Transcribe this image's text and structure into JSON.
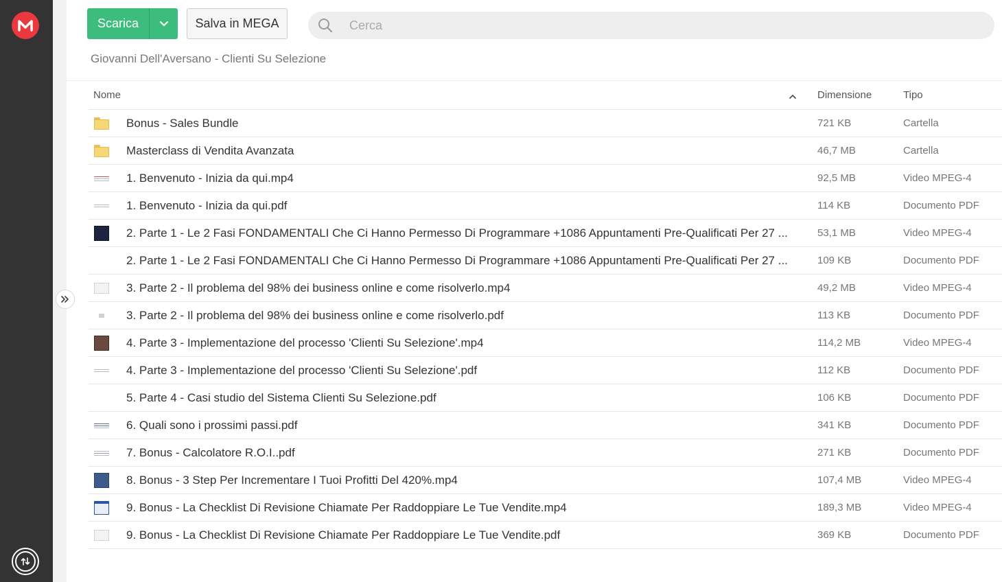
{
  "app": {
    "logo_letter": "M"
  },
  "toolbar": {
    "download_label": "Scarica",
    "save_label": "Salva in MEGA"
  },
  "search": {
    "placeholder": "Cerca"
  },
  "breadcrumb": "Giovanni Dell'Aversano - Clienti Su Selezione",
  "table": {
    "headers": {
      "name": "Nome",
      "size": "Dimensione",
      "type": "Tipo"
    },
    "rows": [
      {
        "thumb": "folder-icon",
        "name": "Bonus - Sales Bundle",
        "size": "721 KB",
        "type": "Cartella"
      },
      {
        "thumb": "folder-icon",
        "name": "Masterclass di Vendita Avanzata",
        "size": "46,7 MB",
        "type": "Cartella"
      },
      {
        "thumb": "video-thumbnail",
        "name": "1. Benvenuto - Inizia da qui.mp4",
        "size": "92,5 MB",
        "type": "Video MPEG-4"
      },
      {
        "thumb": "pdf-thumbnail",
        "name": "1. Benvenuto - Inizia da qui.pdf",
        "size": "114 KB",
        "type": "Documento PDF"
      },
      {
        "thumb": "video-thumbnail",
        "name": "2. Parte 1 - Le 2 Fasi FONDAMENTALI Che Ci Hanno Permesso Di Programmare +1086 Appuntamenti Pre-Qualificati Per 27 ...",
        "size": "53,1 MB",
        "type": "Video MPEG-4"
      },
      {
        "thumb": "pdf-thumbnail",
        "name": "2. Parte 1 - Le 2 Fasi FONDAMENTALI Che Ci Hanno Permesso Di Programmare +1086 Appuntamenti Pre-Qualificati Per 27 ...",
        "size": "109 KB",
        "type": "Documento PDF"
      },
      {
        "thumb": "video-thumbnail",
        "name": "3. Parte 2 - Il problema del 98% dei business online e come risolverlo.mp4",
        "size": "49,2 MB",
        "type": "Video MPEG-4"
      },
      {
        "thumb": "pdf-thumbnail",
        "name": "3. Parte 2 - Il problema del 98% dei business online e come risolverlo.pdf",
        "size": "113 KB",
        "type": "Documento PDF"
      },
      {
        "thumb": "video-thumbnail",
        "name": "4. Parte 3 - Implementazione del processo 'Clienti Su Selezione'.mp4",
        "size": "114,2 MB",
        "type": "Video MPEG-4"
      },
      {
        "thumb": "pdf-thumbnail",
        "name": "4. Parte 3 - Implementazione del processo 'Clienti Su Selezione'.pdf",
        "size": "112 KB",
        "type": "Documento PDF"
      },
      {
        "thumb": "pdf-thumbnail",
        "name": "5. Parte 4 - Casi studio del Sistema Clienti Su Selezione.pdf",
        "size": "106 KB",
        "type": "Documento PDF"
      },
      {
        "thumb": "pdf-thumbnail",
        "name": "6. Quali sono i prossimi passi.pdf",
        "size": "341 KB",
        "type": "Documento PDF"
      },
      {
        "thumb": "pdf-thumbnail",
        "name": "7. Bonus - Calcolatore R.O.I..pdf",
        "size": "271 KB",
        "type": "Documento PDF"
      },
      {
        "thumb": "video-thumbnail",
        "name": "8. Bonus - 3 Step Per Incrementare I Tuoi Profitti Del 420%.mp4",
        "size": "107,4 MB",
        "type": "Video MPEG-4"
      },
      {
        "thumb": "video-thumbnail",
        "name": "9. Bonus - La Checklist Di Revisione Chiamate Per Raddoppiare Le Tue Vendite.mp4",
        "size": "189,3 MB",
        "type": "Video MPEG-4"
      },
      {
        "thumb": "pdf-thumbnail",
        "name": "9. Bonus - La Checklist Di Revisione Chiamate Per Raddoppiare Le Tue Vendite.pdf",
        "size": "369 KB",
        "type": "Documento PDF"
      }
    ]
  },
  "colors": {
    "accent_green": "#3dbd7d",
    "brand_red": "#e9383f",
    "sidebar_bg": "#333333",
    "folder_yellow": "#f6d774"
  }
}
